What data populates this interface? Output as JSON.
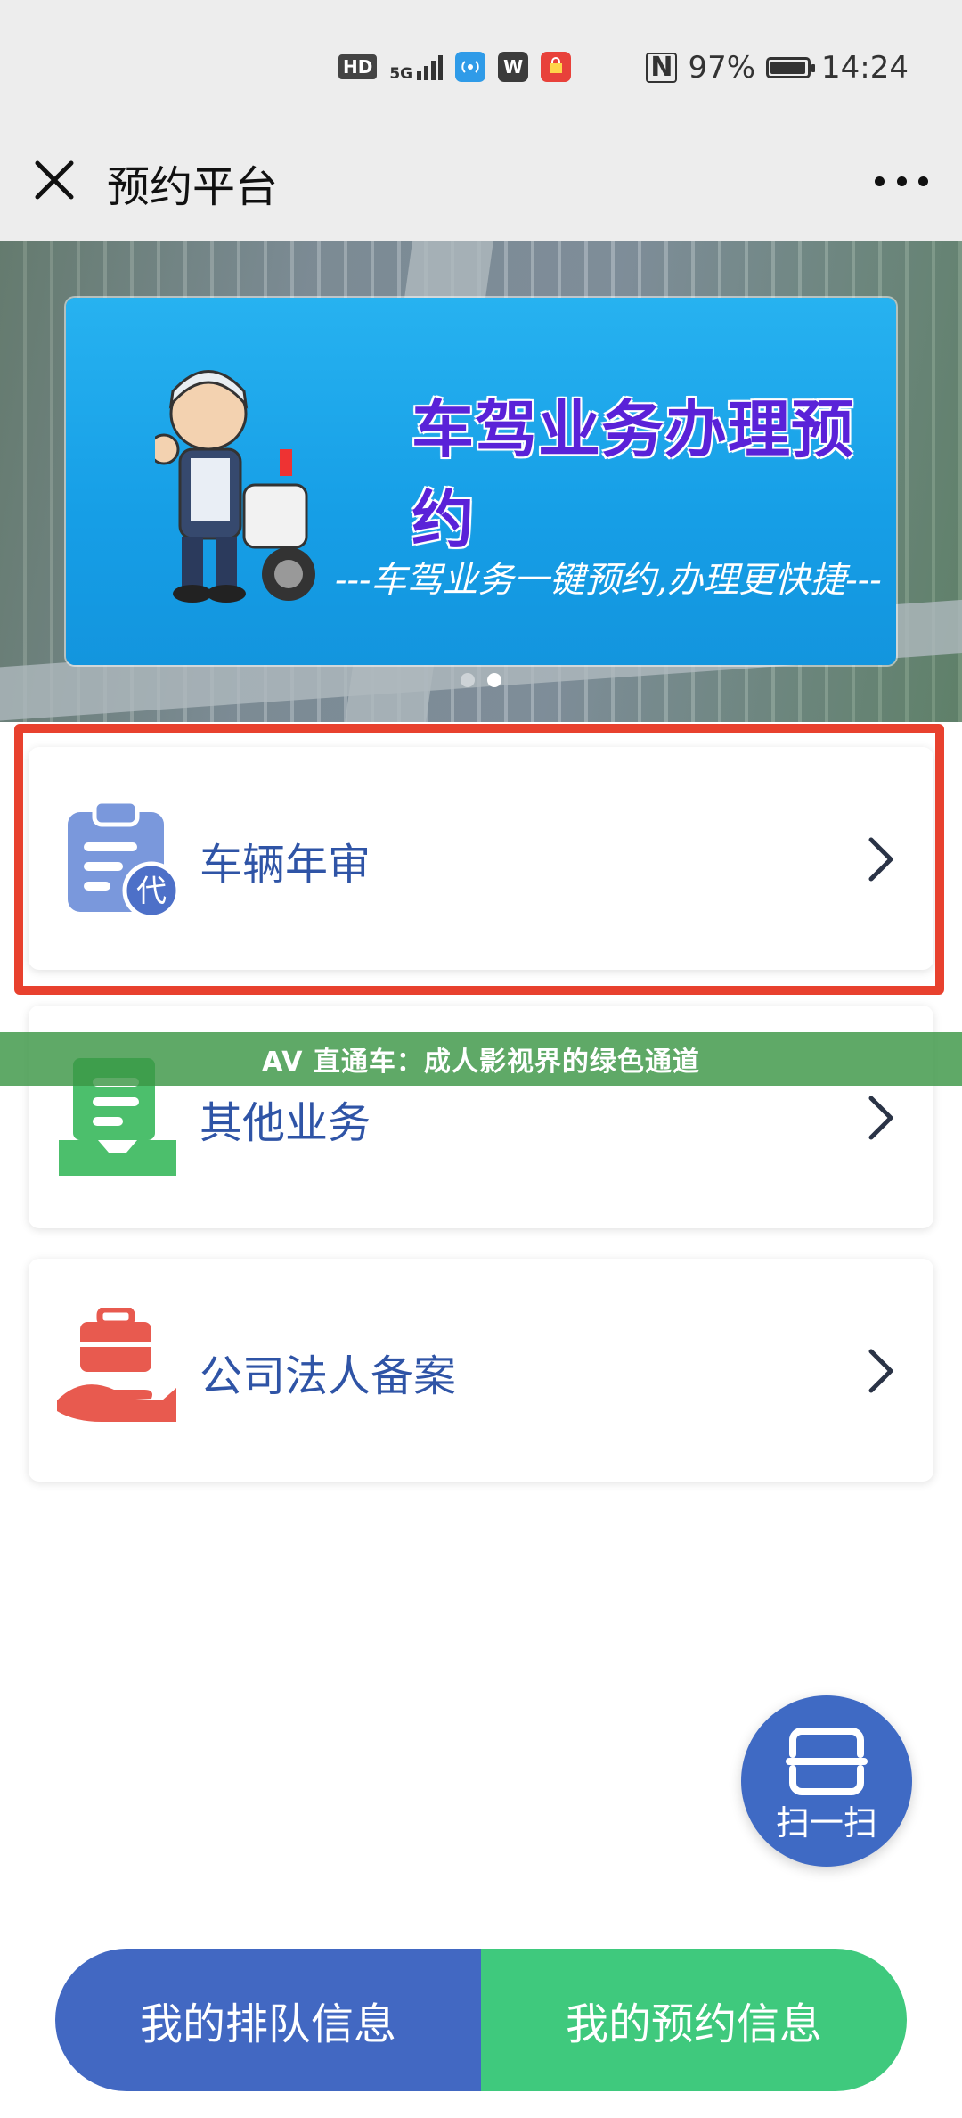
{
  "status_bar": {
    "hd": "HD",
    "network": "5G",
    "wps_app": "W",
    "battery": "97%",
    "time": "14:24",
    "battery_level": 0.97
  },
  "nav": {
    "title": "预约平台"
  },
  "banner": {
    "title": "车驾业务办理预约",
    "subtitle": "---车驾业务一键预约,办理更快捷---",
    "active_slide": 2,
    "slide_count": 2
  },
  "menu": {
    "items": [
      {
        "label": "车辆年审",
        "icon": "clipboard-proxy-icon",
        "color": "#6f8fd8"
      },
      {
        "label": "其他业务",
        "icon": "document-tray-icon",
        "color": "#4cbf6c"
      },
      {
        "label": "公司法人备案",
        "icon": "briefcase-hand-icon",
        "color": "#e85a4f"
      }
    ],
    "highlighted_index": 0,
    "proxy_badge": "代"
  },
  "overlay_banner": {
    "text": "AV 直通车：成人影视界的绿色通道"
  },
  "scan": {
    "label": "扫一扫"
  },
  "bottom": {
    "queue_label": "我的排队信息",
    "booking_label": "我的预约信息"
  },
  "colors": {
    "brand_blue": "#4268c2",
    "brand_green": "#3fc97d",
    "highlight_red": "#e8412e"
  }
}
